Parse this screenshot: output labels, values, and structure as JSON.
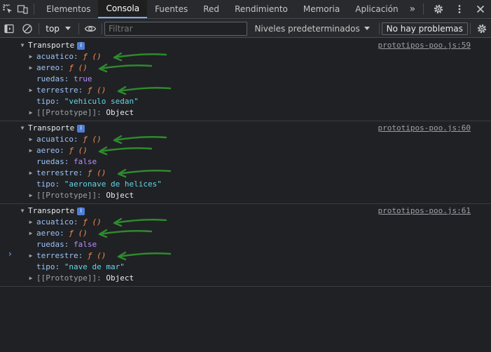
{
  "tabs": [
    {
      "label": "Elementos",
      "active": false
    },
    {
      "label": "Consola",
      "active": true
    },
    {
      "label": "Fuentes",
      "active": false
    },
    {
      "label": "Red",
      "active": false
    },
    {
      "label": "Rendimiento",
      "active": false
    },
    {
      "label": "Memoria",
      "active": false
    },
    {
      "label": "Aplicación",
      "active": false
    }
  ],
  "tab_more": "»",
  "toolbar": {
    "context": "top",
    "filter_placeholder": "Filtrar",
    "levels": "Niveles predeterminados",
    "issues": "No hay problemas"
  },
  "colors": {
    "accent": "#7cacf8",
    "function": "#f28b54",
    "boolean": "#b48eff",
    "string": "#62d6e8",
    "key": "#9cc2f7",
    "annotation_arrow": "#2e8a2e"
  },
  "entries": [
    {
      "name": "Transporte",
      "info_badge": "i",
      "source": "prototipos-poo.js:59",
      "props": [
        {
          "key": "acuatico",
          "value": "ƒ ()",
          "kind": "fn",
          "expandable": true,
          "arrow": true
        },
        {
          "key": "aereo",
          "value": "ƒ ()",
          "kind": "fn",
          "expandable": true,
          "arrow": true
        },
        {
          "key": "ruedas",
          "value": "true",
          "kind": "bool",
          "expandable": false,
          "arrow": false
        },
        {
          "key": "terrestre",
          "value": "ƒ ()",
          "kind": "fn",
          "expandable": true,
          "arrow": true
        },
        {
          "key": "tipo",
          "value": "\"vehiculo sedan\"",
          "kind": "str",
          "expandable": false,
          "arrow": false
        },
        {
          "key": "[[Prototype]]",
          "value": "Object",
          "kind": "obj",
          "expandable": true,
          "arrow": false
        }
      ]
    },
    {
      "name": "Transporte",
      "info_badge": "i",
      "source": "prototipos-poo.js:60",
      "props": [
        {
          "key": "acuatico",
          "value": "ƒ ()",
          "kind": "fn",
          "expandable": true,
          "arrow": true
        },
        {
          "key": "aereo",
          "value": "ƒ ()",
          "kind": "fn",
          "expandable": true,
          "arrow": true
        },
        {
          "key": "ruedas",
          "value": "false",
          "kind": "bool",
          "expandable": false,
          "arrow": false
        },
        {
          "key": "terrestre",
          "value": "ƒ ()",
          "kind": "fn",
          "expandable": true,
          "arrow": true
        },
        {
          "key": "tipo",
          "value": "\"aeronave de helices\"",
          "kind": "str",
          "expandable": false,
          "arrow": false
        },
        {
          "key": "[[Prototype]]",
          "value": "Object",
          "kind": "obj",
          "expandable": true,
          "arrow": false
        }
      ]
    },
    {
      "name": "Transporte",
      "info_badge": "i",
      "source": "prototipos-poo.js:61",
      "props": [
        {
          "key": "acuatico",
          "value": "ƒ ()",
          "kind": "fn",
          "expandable": true,
          "arrow": true
        },
        {
          "key": "aereo",
          "value": "ƒ ()",
          "kind": "fn",
          "expandable": true,
          "arrow": true
        },
        {
          "key": "ruedas",
          "value": "false",
          "kind": "bool",
          "expandable": false,
          "arrow": false
        },
        {
          "key": "terrestre",
          "value": "ƒ ()",
          "kind": "fn",
          "expandable": true,
          "arrow": true
        },
        {
          "key": "tipo",
          "value": "\"nave de mar\"",
          "kind": "str",
          "expandable": false,
          "arrow": false
        },
        {
          "key": "[[Prototype]]",
          "value": "Object",
          "kind": "obj",
          "expandable": true,
          "arrow": false
        }
      ]
    }
  ],
  "prompt": "›"
}
